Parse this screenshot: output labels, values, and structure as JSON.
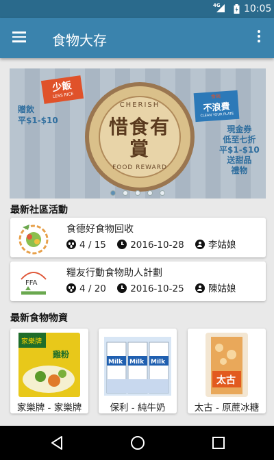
{
  "status_bar": {
    "network": "4G",
    "time": "10:05"
  },
  "app_bar": {
    "title": "食物大存",
    "menu_icon": "menu-icon",
    "more_icon": "more-vert-icon"
  },
  "banner": {
    "main_title": "惜食有賞",
    "seal_top": "CHERISH",
    "seal_bottom": "FOOD REWARD",
    "tag_left_zh": "少飯",
    "tag_left_en": "LESS RICE",
    "tag_right_small": "食碗",
    "tag_right_zh": "不浪費",
    "tag_right_en": "CLEAN YOUR PLATE",
    "left_line1": "贈飲",
    "left_line2": "平$1-$10",
    "right_lines": [
      "現金券",
      "低至七折",
      "平$1-$10",
      "送甜品",
      "禮物"
    ],
    "slides_total": 5,
    "active_slide": 1
  },
  "sections": {
    "community_title": "最新社區活動",
    "food_title": "最新食物物資"
  },
  "activities": [
    {
      "name": "食德好食物回收",
      "participants": "4 / 15",
      "date": "2016-10-28",
      "organizer": "李姑娘",
      "logo_text": ""
    },
    {
      "name": "糧友行動食物助人計劃",
      "participants": "4 / 20",
      "date": "2016-10-25",
      "organizer": "陳姑娘",
      "logo_text": "FFA"
    }
  ],
  "products": [
    {
      "label": "家樂牌 - 家樂牌",
      "brand_text": "家樂牌",
      "pack_text": "雞粉"
    },
    {
      "label": "保利 - 純牛奶",
      "brand_text": "Milk"
    },
    {
      "label": "太古 - 原蔗冰糖",
      "brand_text": "太古"
    }
  ],
  "colors": {
    "status_bar": "#2a6a8c",
    "app_bar": "#3a83ad",
    "background": "#e9e9e9"
  }
}
